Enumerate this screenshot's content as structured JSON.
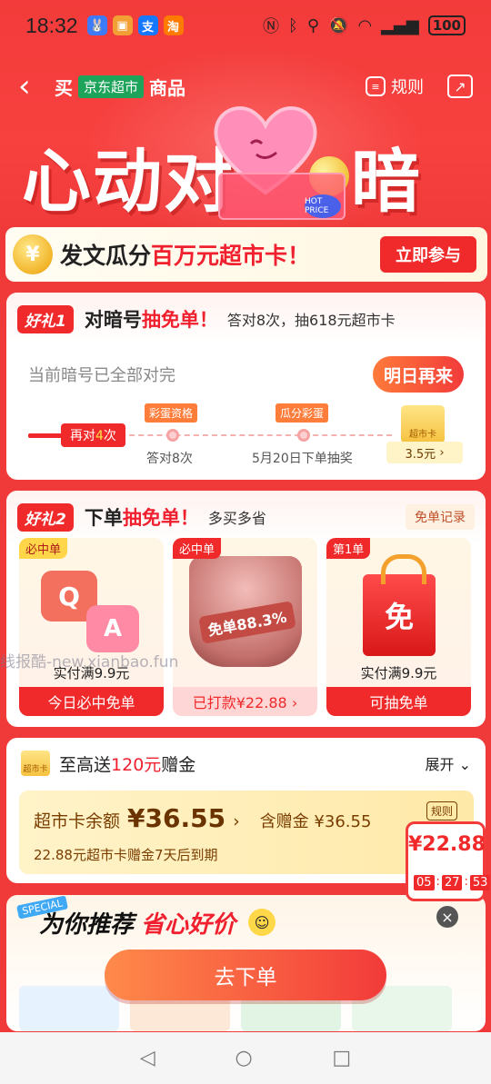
{
  "status_bar": {
    "time": "18:32",
    "battery": "100",
    "app_icons": [
      "fox-app-icon",
      "face-app-icon",
      "alipay-icon",
      "taobao-icon"
    ],
    "app_glyphs": [
      "🐰",
      "▣",
      "支",
      "淘"
    ]
  },
  "nav": {
    "buy": "买",
    "store": "京东超市",
    "goods": "商品",
    "rules": "规则"
  },
  "hero": {
    "title_left": "心动对",
    "title_right": "暗号",
    "hot_badge": "HOT PRICE"
  },
  "banner": {
    "text_prefix": "发文瓜分",
    "text_red": "百万元超市卡",
    "text_suffix": "！",
    "join_button": "立即参与",
    "coin_symbol": "¥"
  },
  "gift1": {
    "tag": "好礼1",
    "title_prefix": "对暗号",
    "title_red": "抽免单",
    "title_suffix": "！",
    "subtitle": "答对8次，抽618元超市卡",
    "status": "当前暗号已全部对完",
    "button": "明日再来",
    "progress_prefix": "再对",
    "progress_num": "4",
    "progress_suffix": "次",
    "node1_tag": "彩蛋资格",
    "node1_label": "答对8次",
    "node2_tag": "瓜分彩蛋",
    "node2_label": "5月20日下单抽奖",
    "card_label": "超市卡",
    "card_price": "3.5元",
    "card_arrow": "›"
  },
  "gift2": {
    "tag": "好礼2",
    "title_prefix": "下单",
    "title_red": "抽免单",
    "title_suffix": "！",
    "subtitle": "多买多省",
    "record_button": "免单记录",
    "tiles": [
      {
        "tag": "必中单",
        "price": "实付满9.9元",
        "button": "今日必中免单"
      },
      {
        "tag": "必中单",
        "badge": "免单88.3%",
        "button": "已打款¥22.88 ›"
      },
      {
        "tag": "第1单",
        "price": "实付满9.9元",
        "button": "可抽免单",
        "bag_text": "免"
      }
    ]
  },
  "watermark": "线报酷-new.xianbao.fun",
  "supermarket": {
    "card_label": "超市卡",
    "title_prefix": "至高送",
    "title_red": "120元",
    "title_suffix": "赠金",
    "expand": "展开",
    "balance_label": "超市卡余额",
    "balance_amount": "¥36.55",
    "balance_arrow": "›",
    "gift_label": "含赠金 ¥36.55",
    "rules": "规则",
    "expiry_note": "22.88元超市卡赠金7天后到期"
  },
  "float_badge": {
    "price": "¥22.88",
    "h": "05",
    "m": "27",
    "s": "53"
  },
  "recommend": {
    "special": "SPECIAL",
    "title": "为你推荐",
    "title_red": "省心好价",
    "order_button": "去下单"
  },
  "colors": {
    "brand_red": "#f02a2a",
    "jd_green": "#1ea35a",
    "gold": "#f6c23f"
  }
}
